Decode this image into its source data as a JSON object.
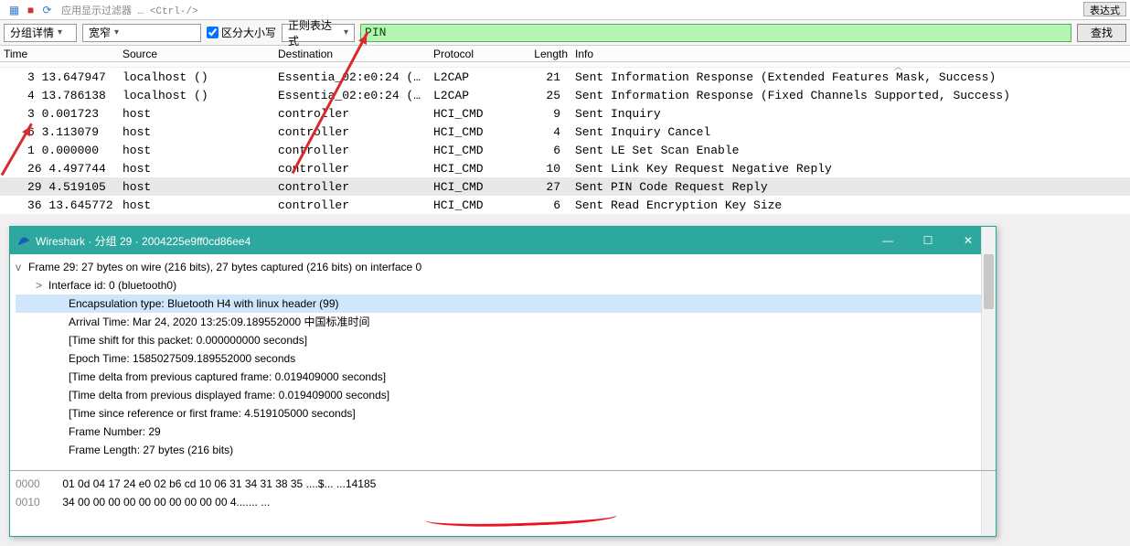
{
  "toolbar": {
    "hint_text": "应用显示过滤器 … <Ctrl-/>",
    "expr_button": "表达式"
  },
  "filterbar": {
    "group_detail": "分组详情",
    "width_mode": "宽窄",
    "case_sensitive": "区分大小写",
    "regex_mode": "正则表达式",
    "search_value": "PIN",
    "find_button": "查找"
  },
  "packet_table": {
    "headers": {
      "time": "Time",
      "source": "Source",
      "dest": "Destination",
      "proto": "Protocol",
      "len": "Length",
      "info": "Info"
    },
    "rows": [
      {
        "no": "3",
        "time": "3 13.647947",
        "source": "localhost ()",
        "dest": "Essentia_02:e0:24 (…",
        "proto": "L2CAP",
        "len": "21",
        "info": "Sent Information Response (Extended Features Mask, Success)"
      },
      {
        "no": "4",
        "time": "4 13.786138",
        "source": "localhost ()",
        "dest": "Essentia_02:e0:24 (…",
        "proto": "L2CAP",
        "len": "25",
        "info": "Sent Information Response (Fixed Channels Supported, Success)"
      },
      {
        "no": "3",
        "time": "3 0.001723",
        "source": "host",
        "dest": "controller",
        "proto": "HCI_CMD",
        "len": "9",
        "info": "Sent Inquiry"
      },
      {
        "no": "6",
        "time": "6 3.113079",
        "source": "host",
        "dest": "controller",
        "proto": "HCI_CMD",
        "len": "4",
        "info": "Sent Inquiry Cancel"
      },
      {
        "no": "1",
        "time": "1 0.000000",
        "source": "host",
        "dest": "controller",
        "proto": "HCI_CMD",
        "len": "6",
        "info": "Sent LE Set Scan Enable"
      },
      {
        "no": "26",
        "time": "26 4.497744",
        "source": "host",
        "dest": "controller",
        "proto": "HCI_CMD",
        "len": "10",
        "info": "Sent Link Key Request Negative Reply"
      },
      {
        "no": "29",
        "time": "29 4.519105",
        "source": "host",
        "dest": "controller",
        "proto": "HCI_CMD",
        "len": "27",
        "info": "Sent PIN Code Request Reply",
        "sel": true
      },
      {
        "no": "36",
        "time": "36 13.645772",
        "source": "host",
        "dest": "controller",
        "proto": "HCI_CMD",
        "len": "6",
        "info": "Sent Read Encryption Key Size"
      }
    ]
  },
  "detail_window": {
    "title": "Wireshark · 分组 29 · 2004225e9ff0cd86ee4",
    "lines": [
      {
        "ind": 0,
        "caret": "v",
        "text": "Frame 29: 27 bytes on wire (216 bits), 27 bytes captured (216 bits) on interface 0"
      },
      {
        "ind": 1,
        "caret": ">",
        "text": "Interface id: 0 (bluetooth0)"
      },
      {
        "ind": 2,
        "caret": "",
        "text": "Encapsulation type: Bluetooth H4 with linux header (99)",
        "hl": true
      },
      {
        "ind": 2,
        "caret": "",
        "text": "Arrival Time: Mar 24, 2020 13:25:09.189552000 中国标准时间"
      },
      {
        "ind": 2,
        "caret": "",
        "text": "[Time shift for this packet: 0.000000000 seconds]"
      },
      {
        "ind": 2,
        "caret": "",
        "text": "Epoch Time: 1585027509.189552000 seconds"
      },
      {
        "ind": 2,
        "caret": "",
        "text": "[Time delta from previous captured frame: 0.019409000 seconds]"
      },
      {
        "ind": 2,
        "caret": "",
        "text": "[Time delta from previous displayed frame: 0.019409000 seconds]"
      },
      {
        "ind": 2,
        "caret": "",
        "text": "[Time since reference or first frame: 4.519105000 seconds]"
      },
      {
        "ind": 2,
        "caret": "",
        "text": "Frame Number: 29"
      },
      {
        "ind": 2,
        "caret": "",
        "text": "Frame Length: 27 bytes (216 bits)"
      }
    ],
    "hex": [
      {
        "off": "0000",
        "bytes": "01 0d 04 17 24 e0 02 b6  cd 10 06 31 34 31 38 35",
        "ascii": "....$... ...14185"
      },
      {
        "off": "0010",
        "bytes": "34 00 00 00 00 00 00 00  00 00 00",
        "ascii": "4....... ..."
      }
    ]
  }
}
